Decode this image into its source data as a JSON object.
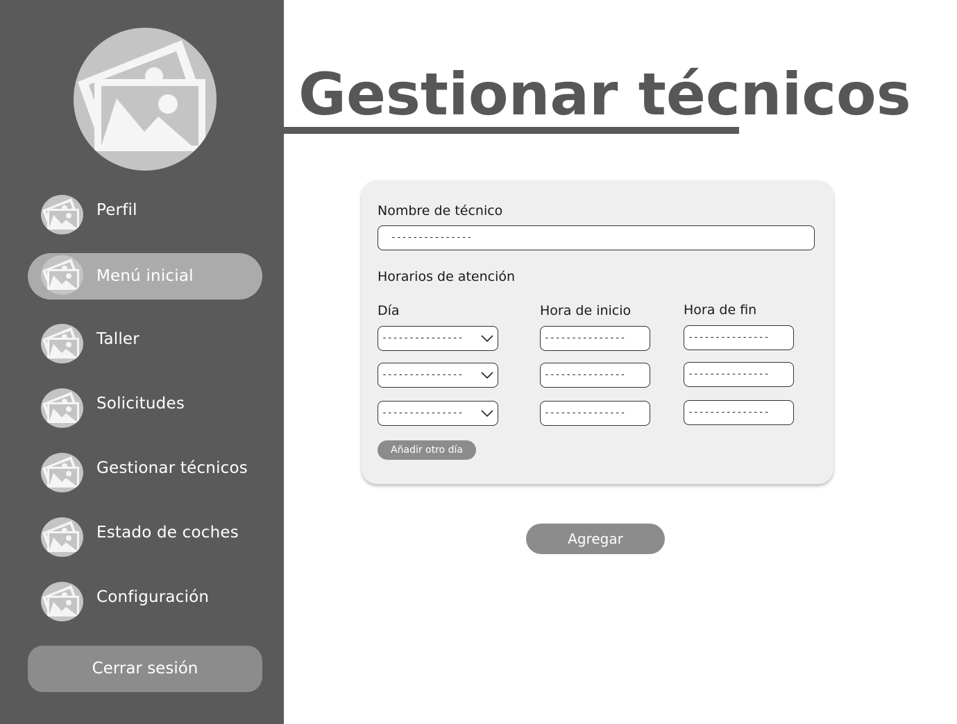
{
  "sidebar": {
    "avatar_icon": "image-placeholder-icon",
    "items": [
      {
        "label": "Perfil",
        "icon": "image-placeholder-icon",
        "active": false
      },
      {
        "label": "Menú inicial",
        "icon": "image-placeholder-icon",
        "active": true
      },
      {
        "label": "Taller",
        "icon": "image-placeholder-icon",
        "active": false
      },
      {
        "label": "Solicitudes",
        "icon": "image-placeholder-icon",
        "active": false
      },
      {
        "label": "Gestionar técnicos",
        "icon": "image-placeholder-icon",
        "active": false
      },
      {
        "label": "Estado de coches",
        "icon": "image-placeholder-icon",
        "active": false
      },
      {
        "label": "Configuración",
        "icon": "image-placeholder-icon",
        "active": false
      }
    ],
    "logout_label": "Cerrar sesión"
  },
  "main": {
    "title": "Gestionar técnicos",
    "form": {
      "name_label": "Nombre de técnico",
      "name_value": "---------------",
      "schedule_label": "Horarios de atención",
      "columns": {
        "day": "Día",
        "start": "Hora de inicio",
        "end": "Hora de fin"
      },
      "rows": [
        {
          "day": "---------------",
          "start": "---------------",
          "end": "---------------"
        },
        {
          "day": "---------------",
          "start": "---------------",
          "end": "---------------"
        },
        {
          "day": "---------------",
          "start": "---------------",
          "end": "---------------"
        }
      ],
      "add_day_label": "Añadir otro día"
    },
    "submit_label": "Agregar"
  },
  "colors": {
    "sidebar_bg": "#5a5a5a",
    "active_item_bg": "#ababab",
    "button_bg": "#8c8c8c",
    "card_bg": "#efefef",
    "title_color": "#575757"
  }
}
